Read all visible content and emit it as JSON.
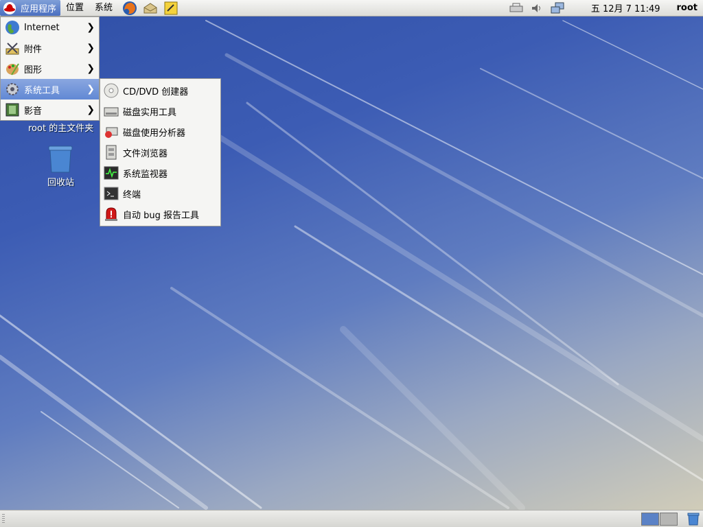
{
  "top_panel": {
    "menus": [
      "应用程序",
      "位置",
      "系统"
    ],
    "clock": "五 12月  7 11:49",
    "user": "root"
  },
  "app_menu": {
    "items": [
      {
        "label": "Internet",
        "icon": "globe-icon"
      },
      {
        "label": "附件",
        "icon": "accessories-icon"
      },
      {
        "label": "图形",
        "icon": "graphics-icon"
      },
      {
        "label": "系统工具",
        "icon": "gear-icon"
      },
      {
        "label": "影音",
        "icon": "film-icon"
      }
    ],
    "active_index": 3
  },
  "sub_menu": {
    "items": [
      {
        "label": "CD/DVD 创建器",
        "icon": "cd-icon"
      },
      {
        "label": "磁盘实用工具",
        "icon": "disk-utility-icon"
      },
      {
        "label": "磁盘使用分析器",
        "icon": "disk-analyzer-icon"
      },
      {
        "label": "文件浏览器",
        "icon": "file-cabinet-icon"
      },
      {
        "label": "系统监视器",
        "icon": "system-monitor-icon"
      },
      {
        "label": "终端",
        "icon": "terminal-icon"
      },
      {
        "label": "自动 bug 报告工具",
        "icon": "bug-alert-icon"
      }
    ]
  },
  "desktop": {
    "home_label": "root 的主文件夹",
    "trash_label": "回收站"
  },
  "colors": {
    "accent": "#6189d4",
    "panel": "#e4e4e0"
  }
}
